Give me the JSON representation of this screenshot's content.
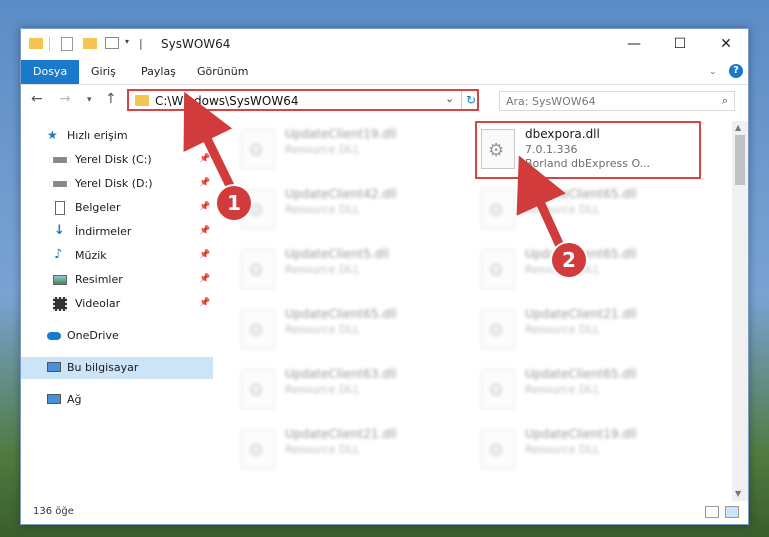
{
  "window": {
    "title": "SysWOW64",
    "controls": [
      "—",
      "☐",
      "✕"
    ]
  },
  "ribbon": {
    "tabs": [
      "Dosya",
      "Giriş",
      "Paylaş",
      "Görünüm"
    ],
    "active": "Dosya",
    "help": "?"
  },
  "address": {
    "path": "C:\\Windows\\SysWOW64"
  },
  "search": {
    "placeholder": "Ara: SysWOW64"
  },
  "sidebar": {
    "quick_access": "Hızlı erişim",
    "items": [
      {
        "label": "Yerel Disk (C:)",
        "icon": "drive-icon",
        "pinned": true
      },
      {
        "label": "Yerel Disk (D:)",
        "icon": "drive-icon",
        "pinned": true
      },
      {
        "label": "Belgeler",
        "icon": "documents-icon",
        "pinned": true
      },
      {
        "label": "İndirmeler",
        "icon": "download-icon",
        "pinned": true
      },
      {
        "label": "Müzik",
        "icon": "music-icon",
        "pinned": true
      },
      {
        "label": "Resimler",
        "icon": "pictures-icon",
        "pinned": true
      },
      {
        "label": "Videolar",
        "icon": "videos-icon",
        "pinned": true
      }
    ],
    "onedrive": "OneDrive",
    "this_pc": "Bu bilgisayar",
    "network": "Ağ"
  },
  "files": {
    "highlighted": {
      "name": "dbexpora.dll",
      "version": "7.0.1.336",
      "description": "Borland dbExpress O..."
    },
    "blurred_left": [
      {
        "name": "UpdateClient19.dll",
        "type": "Resource DLL"
      },
      {
        "name": "UpdateClient42.dll",
        "type": "Resource DLL"
      },
      {
        "name": "UpdateClient5.dll",
        "type": "Resource DLL"
      },
      {
        "name": "UpdateClient65.dll",
        "type": "Resource DLL"
      },
      {
        "name": "UpdateClient63.dll",
        "type": "Resource DLL"
      },
      {
        "name": "UpdateClient21.dll",
        "type": "Resource DLL"
      }
    ],
    "blurred_right": [
      {
        "name": "UpdateClient65.dll",
        "type": "Resource DLL"
      },
      {
        "name": "UpdateClient65.dll",
        "type": "Resource DLL"
      },
      {
        "name": "UpdateClient21.dll",
        "type": "Resource DLL"
      },
      {
        "name": "UpdateClient65.dll",
        "type": "Resource DLL"
      },
      {
        "name": "UpdateClient19.dll",
        "type": "Resource DLL"
      }
    ]
  },
  "status": {
    "count": "136 öğe"
  },
  "callouts": [
    "1",
    "2"
  ],
  "colors": {
    "accent": "#1979ca",
    "highlight": "#d64545",
    "callout": "#d13b3b",
    "selected": "#cce4f7"
  }
}
